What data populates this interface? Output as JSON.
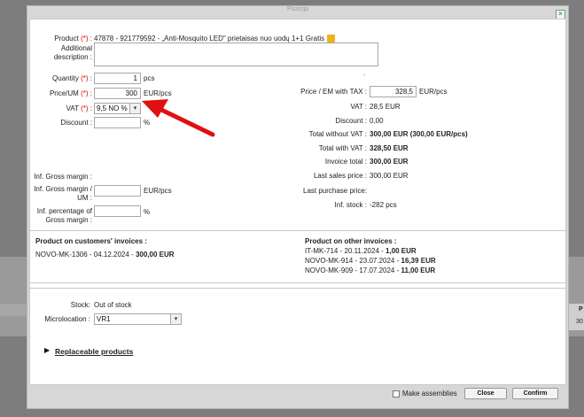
{
  "window": {
    "title": "Pozicija"
  },
  "left": {
    "product_label": "Product",
    "product_value": "47878 - 921779592 - „Anti-Mosquito LED\" prietaisas nuo uodų 1+1 Gratis",
    "additional_desc_label": "Additional description :",
    "quantity_label": "Quantity",
    "quantity_value": "1",
    "quantity_unit": "pcs",
    "price_label": "Price/UM",
    "price_value": "300",
    "price_unit": "EUR/pcs",
    "vat_label": "VAT",
    "vat_value": "9,5 NO %",
    "discount_label": "Discount :",
    "discount_unit": "%",
    "gross_margin_label": "Inf. Gross margin :",
    "gross_margin_um_label": "Inf. Gross margin / UM :",
    "gross_margin_um_unit": "EUR/pcs",
    "percentage_gross_margin_label": "Inf. percentage of Gross margin :",
    "percentage_unit": "%",
    "req_mark": "(*)",
    "colon": ":"
  },
  "right": {
    "dot": ".",
    "price_with_tax_label": "Price / EM with TAX :",
    "price_with_tax_value": "328,5",
    "price_with_tax_unit": "EUR/pcs",
    "vat_label": "VAT :",
    "vat_value": "28,5 EUR",
    "discount_label": "Discount :",
    "discount_value": "0,00",
    "total_without_vat_label": "Total without VAT :",
    "total_without_vat_value": "300,00 EUR (300,00 EUR/pcs)",
    "total_with_vat_label": "Total with VAT :",
    "total_with_vat_value": "328,50 EUR",
    "invoice_total_label": "Invoice total :",
    "invoice_total_value": "300,00 EUR",
    "last_sales_label": "Last sales price :",
    "last_sales_value": "300,00 EUR",
    "last_purchase_label": "Last purchase price:",
    "inf_stock_label": "Inf. stock :",
    "inf_stock_value": "-282 pcs"
  },
  "invoices": {
    "customers_title": "Product on customers' invoices :",
    "customers_items": [
      {
        "ref": "NOVO-MK-1306 - 04.12.2024 - ",
        "amount": "300,00 EUR"
      }
    ],
    "other_title": "Product on other invoices :",
    "other_items": [
      {
        "ref": "IT-MK-714 - 20.11.2024 - ",
        "amount": "1,00 EUR"
      },
      {
        "ref": "NOVO-MK-914 - 23.07.2024 - ",
        "amount": "16,39 EUR"
      },
      {
        "ref": "NOVO-MK-909 - 17.07.2024 - ",
        "amount": "11,00 EUR"
      }
    ]
  },
  "stock": {
    "stock_label": "Stock:",
    "stock_value": "Out of stock",
    "microlocation_label": "Microlocation :",
    "microlocation_value": "VR1",
    "replaceable_label": "Replaceable products"
  },
  "footer": {
    "make_assemblies_label": "Make assemblies",
    "close_label": "Close",
    "confirm_label": "Confirm"
  },
  "background": {
    "right_text_1": "P",
    "right_text_2": "30"
  },
  "colors": {
    "arrow": "#e01010",
    "pencil": "#f2b01e"
  }
}
